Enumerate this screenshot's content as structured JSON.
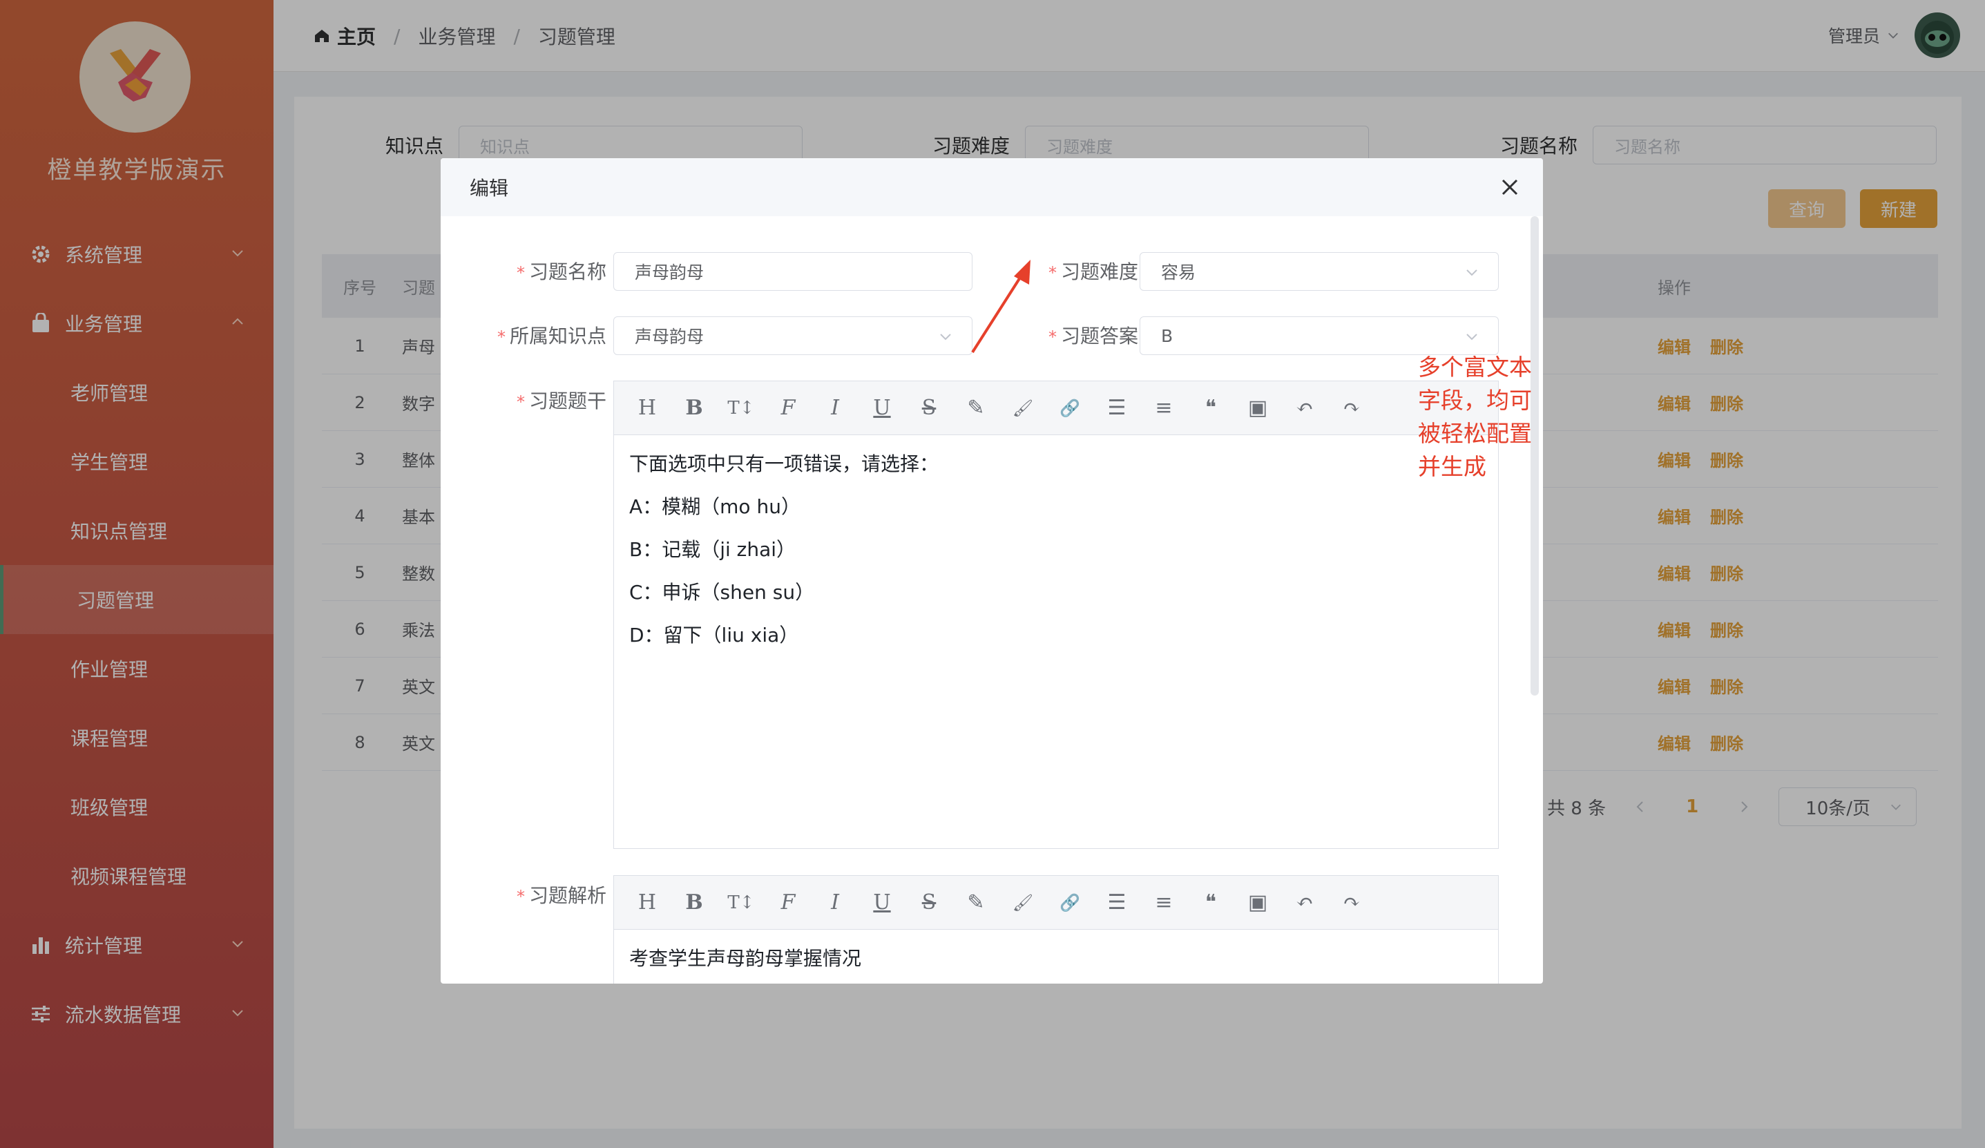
{
  "app": {
    "title": "橙单教学版演示"
  },
  "sidebar": {
    "items": [
      {
        "label": "系统管理",
        "icon": "gear-icon",
        "expanded": false
      },
      {
        "label": "业务管理",
        "icon": "bag-icon",
        "expanded": true
      },
      {
        "label": "统计管理",
        "icon": "bar-chart-icon",
        "expanded": false
      },
      {
        "label": "流水数据管理",
        "icon": "sliders-icon",
        "expanded": false
      }
    ],
    "sub": [
      "老师管理",
      "学生管理",
      "知识点管理",
      "习题管理",
      "作业管理",
      "课程管理",
      "班级管理",
      "视频课程管理"
    ],
    "active_sub": "习题管理"
  },
  "header": {
    "breadcrumb": [
      "主页",
      "业务管理",
      "习题管理"
    ],
    "user": "管理员"
  },
  "filters": {
    "knowledge_label": "知识点",
    "knowledge_placeholder": "知识点",
    "difficulty_label": "习题难度",
    "difficulty_placeholder": "习题难度",
    "name_label": "习题名称",
    "name_placeholder": "习题名称",
    "query_btn": "查询",
    "new_btn": "新建"
  },
  "table": {
    "headers": {
      "no": "序号",
      "name": "习题",
      "op": "操作"
    },
    "rows": [
      {
        "no": "1",
        "name": "声母"
      },
      {
        "no": "2",
        "name": "数字"
      },
      {
        "no": "3",
        "name": "整体"
      },
      {
        "no": "4",
        "name": "基本"
      },
      {
        "no": "5",
        "name": "整数"
      },
      {
        "no": "6",
        "name": "乘法"
      },
      {
        "no": "7",
        "name": "英文"
      },
      {
        "no": "8",
        "name": "英文"
      }
    ],
    "edit": "编辑",
    "delete": "删除"
  },
  "pagination": {
    "total": "共 8 条",
    "page": "1",
    "page_size": "10条/页"
  },
  "dialog": {
    "title": "编辑",
    "annotation": "多个富文本字段，均可被轻松配置并生成",
    "fields": {
      "name_label": "习题名称",
      "name_value": "声母韵母",
      "difficulty_label": "习题难度",
      "difficulty_value": "容易",
      "knowledge_label": "所属知识点",
      "knowledge_value": "声母韵母",
      "answer_label": "习题答案",
      "answer_value": "B",
      "stem_label": "习题题干",
      "analysis_label": "习题解析"
    },
    "stem_lines": [
      "下面选项中只有一项错误，请选择：",
      "A：模糊（mo hu）",
      "B：记载（ji zhai）",
      "C：申诉（shen su）",
      "D：留下（liu xia）"
    ],
    "analysis_text": "考查学生声母韵母掌握情况",
    "toolbar": [
      "H",
      "B",
      "T↕",
      "F",
      "I",
      "U",
      "S",
      "✎",
      "🖌",
      "🔗",
      "☰",
      "≡",
      "❝",
      "▣",
      "↶",
      "↷"
    ]
  },
  "colors": {
    "accent": "#e6a23c",
    "sidebar_top": "#d2683f",
    "sidebar_bottom": "#b54848",
    "required": "#f56c6c",
    "annotation": "#e6402b"
  }
}
